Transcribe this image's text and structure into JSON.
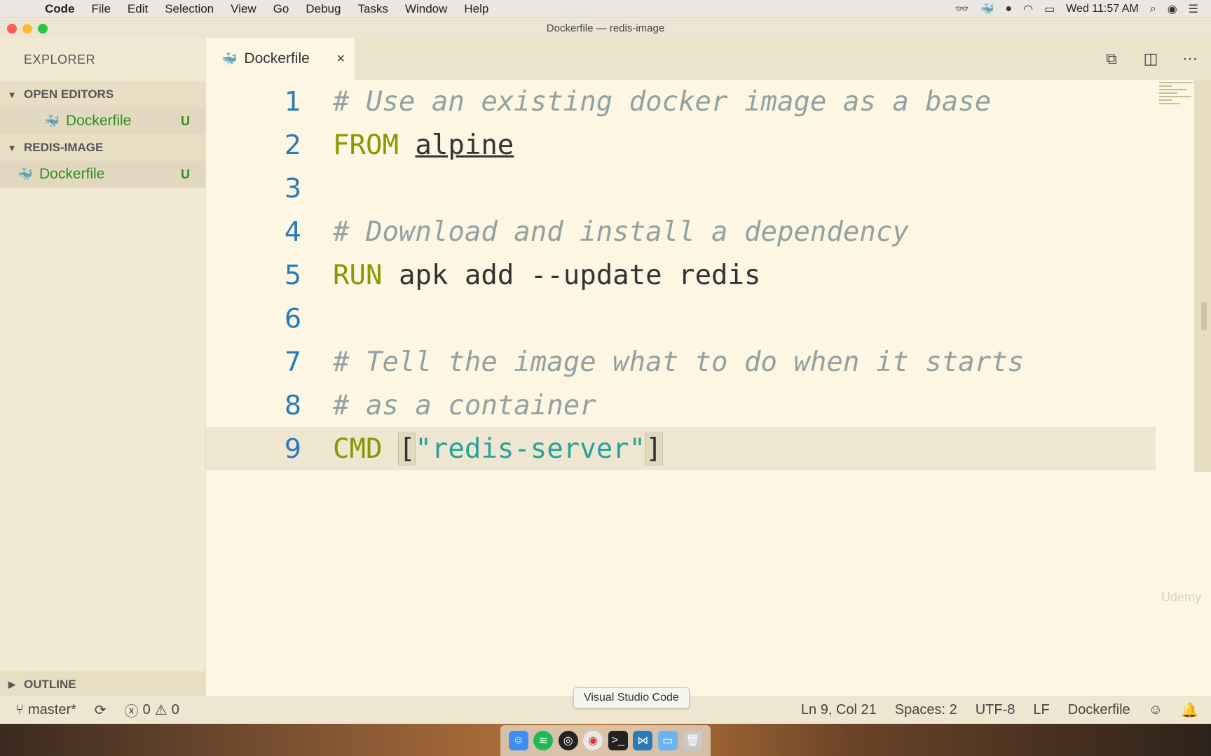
{
  "menubar": {
    "apple": "",
    "app": "Code",
    "items": [
      "File",
      "Edit",
      "Selection",
      "View",
      "Go",
      "Debug",
      "Tasks",
      "Window",
      "Help"
    ],
    "clock": "Wed 11:57 AM"
  },
  "window": {
    "title": "Dockerfile — redis-image"
  },
  "sidebar": {
    "title": "EXPLORER",
    "open_editors": {
      "label": "OPEN EDITORS",
      "files": [
        {
          "name": "Dockerfile",
          "status": "U"
        }
      ]
    },
    "project": {
      "label": "REDIS-IMAGE",
      "files": [
        {
          "name": "Dockerfile",
          "status": "U"
        }
      ]
    },
    "outline": "OUTLINE"
  },
  "tab": {
    "label": "Dockerfile",
    "close": "×"
  },
  "editor": {
    "lines": [
      {
        "n": "1",
        "comment": "# Use an existing docker image as a base"
      },
      {
        "n": "2",
        "kw": "FROM",
        "arg": "alpine"
      },
      {
        "n": "3"
      },
      {
        "n": "4",
        "comment": "# Download and install a dependency"
      },
      {
        "n": "5",
        "kw": "RUN",
        "rest": "apk add --update redis"
      },
      {
        "n": "6"
      },
      {
        "n": "7",
        "comment": "# Tell the image what to do when it starts"
      },
      {
        "n": "8",
        "comment": "# as a container"
      },
      {
        "n": "9",
        "kw": "CMD",
        "open": "[",
        "str": "\"redis-server\"",
        "close": "]"
      }
    ],
    "watermark": "Udemy"
  },
  "statusbar": {
    "branch": "master*",
    "errors": "0",
    "warnings": "0",
    "position": "Ln 9, Col 21",
    "spaces": "Spaces: 2",
    "encoding": "UTF-8",
    "eol": "LF",
    "language": "Dockerfile"
  },
  "tooltip": "Visual Studio Code",
  "colors": {
    "editor_bg": "#fdf6e3",
    "keyword": "#859900",
    "comment": "#93a1a1",
    "string": "#2aa198",
    "line_number": "#2a7ab8",
    "git_untracked": "#2f8f1f"
  }
}
